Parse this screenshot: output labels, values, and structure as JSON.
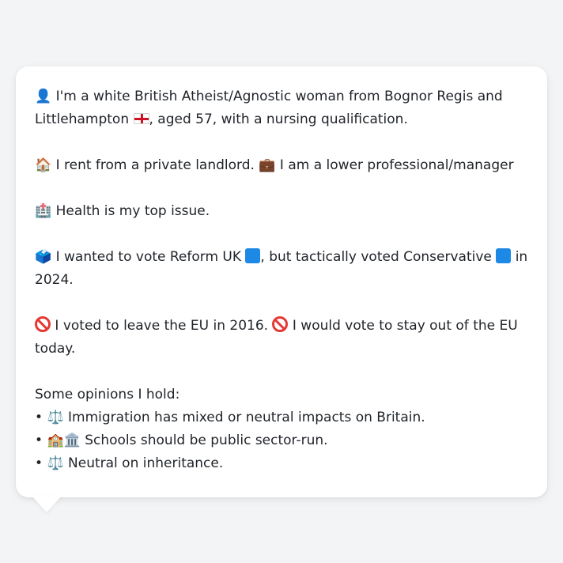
{
  "profile": {
    "intro": {
      "icon": "person-silhouette-icon",
      "text_a": "I'm a white British Atheist/Agnostic woman from Bognor Regis and Littlehampton",
      "flag": "england-flag-icon",
      "text_b": ", aged 57, with a nursing qualification."
    },
    "housing": {
      "house_icon": "house-icon",
      "text_a": "I rent from a private landlord.",
      "briefcase_icon": "briefcase-icon",
      "text_b": "I am a lower professional/manager"
    },
    "issue": {
      "icon": "hospital-icon",
      "text": "Health is my top issue."
    },
    "vote": {
      "icon": "ballot-box-icon",
      "text_a": "I wanted to vote Reform UK",
      "text_b": ", but tactically voted Conservative",
      "text_c": "in 2024."
    },
    "brexit": {
      "icon": "prohibited-icon",
      "text_a": "I voted to leave the EU in 2016.",
      "text_b": "I would vote to stay out of the EU today."
    },
    "opinions": {
      "heading": "Some opinions I hold:",
      "items": [
        {
          "bullet": "•",
          "emoji": "⚖️",
          "text": "Immigration has mixed or neutral impacts on Britain."
        },
        {
          "bullet": "•",
          "emoji": "🏫🏛️",
          "text": "Schools should be public sector-run."
        },
        {
          "bullet": "•",
          "emoji": "⚖️",
          "text": "Neutral on inheritance."
        }
      ]
    }
  }
}
